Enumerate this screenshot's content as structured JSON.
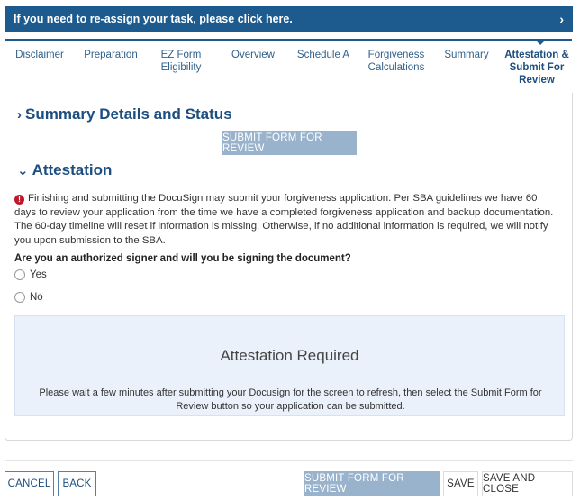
{
  "reassign": {
    "text": "If you need to re-assign your task, please click here.",
    "chevron": "›"
  },
  "steps": [
    {
      "label": "Disclaimer"
    },
    {
      "label": "Preparation"
    },
    {
      "label": "EZ Form Eligibility"
    },
    {
      "label": "Overview"
    },
    {
      "label": "Schedule A"
    },
    {
      "label": "Forgiveness Calculations"
    },
    {
      "label": "Summary"
    },
    {
      "label": "Attestation & Submit For Review",
      "active": true
    }
  ],
  "summary_section": {
    "caret": "›",
    "title": "Summary Details and Status",
    "submit_label": "SUBMIT FORM FOR REVIEW"
  },
  "attestation_section": {
    "caret": "⌄",
    "title": "Attestation",
    "notice": "Finishing and submitting the DocuSign may submit your forgiveness application. Per SBA guidelines we have 60 days to review your application from the time we have a completed forgiveness application and backup documentation. The 60-day timeline will reset if information is missing. Otherwise, if no additional information is required, we will notify you upon submission to the SBA.",
    "question": "Are you an authorized signer and will you be signing the document?",
    "options": [
      "Yes",
      "No"
    ],
    "box_title": "Attestation Required",
    "box_text": "Please wait a few minutes after submitting your Docusign for the screen to refresh, then select the Submit Form for Review button so your application can be submitted."
  },
  "footer": {
    "cancel": "CANCEL",
    "back": "BACK",
    "submit": "SUBMIT FORM FOR REVIEW",
    "save": "SAVE",
    "save_close": "SAVE AND CLOSE"
  }
}
